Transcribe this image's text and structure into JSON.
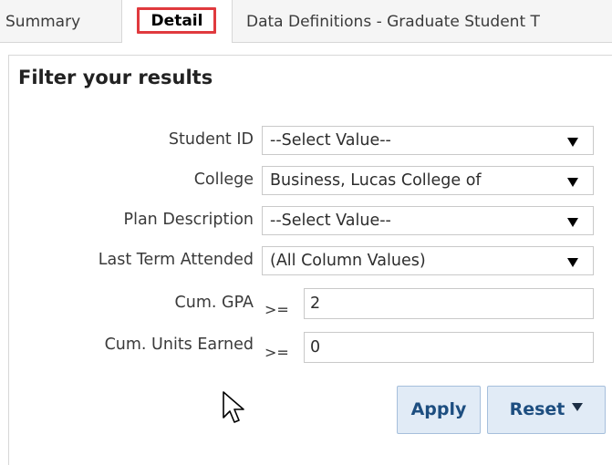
{
  "tabs": [
    {
      "label": "Summary",
      "selected": false
    },
    {
      "label": "Detail",
      "selected": true
    },
    {
      "label": "Data Definitions - Graduate Student T",
      "selected": false
    }
  ],
  "filter": {
    "title": "Filter your results",
    "fields": [
      {
        "label": "Student ID",
        "type": "select",
        "value": "--Select Value--"
      },
      {
        "label": "College",
        "type": "select",
        "value": "Business, Lucas College of"
      },
      {
        "label": "Plan Description",
        "type": "select",
        "value": "--Select Value--"
      },
      {
        "label": "Last Term Attended",
        "type": "select",
        "value": "(All Column Values)"
      },
      {
        "label": "Cum. GPA",
        "type": "input",
        "operator": ">=",
        "value": "2"
      },
      {
        "label": "Cum. Units Earned",
        "type": "input",
        "operator": ">=",
        "value": "0"
      }
    ]
  },
  "buttons": {
    "apply_label": "Apply",
    "reset_label": "Reset"
  },
  "icons": {
    "dropdown": "triangle-down-icon",
    "cursor": "mouse-pointer-icon"
  },
  "colors": {
    "highlight_border": "#e03a3e",
    "button_text": "#1d4e80",
    "button_bg": "#e1ebf6"
  }
}
